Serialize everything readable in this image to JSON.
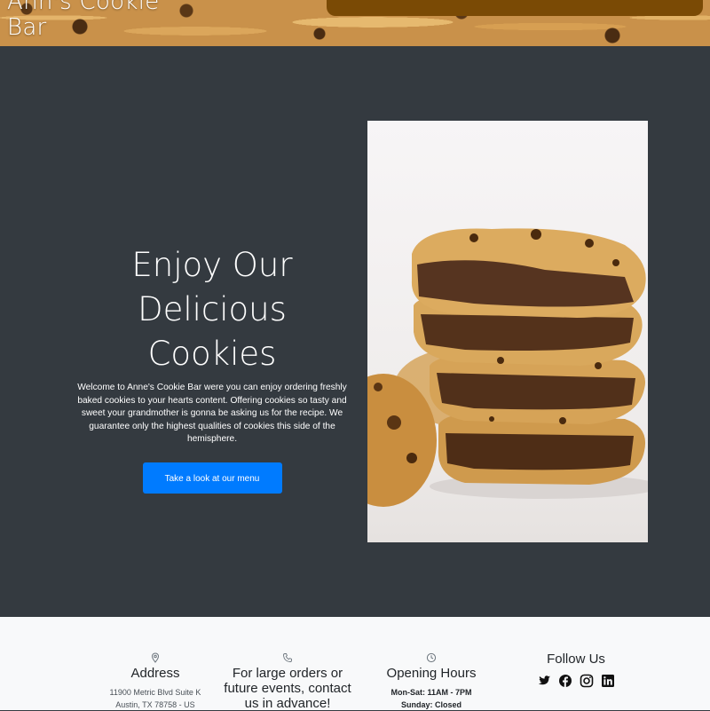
{
  "brand": {
    "name": "Ann's Cookie Bar"
  },
  "hero": {
    "title": "Enjoy Our Delicious Cookies",
    "description": "Welcome to Anne's Cookie Bar were you can enjoy ordering freshly baked cookies to your hearts content. Offering cookies so tasty and sweet your grandmother is gonna be asking us for the recipe. We guarantee only the highest qualities of cookies this side of the hemisphere.",
    "cta_label": "Take a look at our menu",
    "photo_icon": "cookie-stack-photo"
  },
  "footer": {
    "address": {
      "icon": "map-pin-icon",
      "heading": "Address",
      "line1": "11900 Metric Blvd Suite K",
      "line2": "Austin, TX 78758 - US"
    },
    "contact": {
      "icon": "phone-icon",
      "heading": "For large orders or future events, contact us in advance!"
    },
    "hours": {
      "icon": "clock-icon",
      "heading": "Opening Hours",
      "weekdays": "Mon-Sat: 11AM - 7PM",
      "sunday": "Sunday: Closed"
    },
    "social": {
      "heading": "Follow Us",
      "icons": [
        "twitter-icon",
        "facebook-icon",
        "instagram-icon",
        "linkedin-icon"
      ]
    }
  },
  "colors": {
    "hero_bg": "#343a40",
    "footer_bg": "#f8f9fa",
    "cta": "#007bff",
    "topbar": "#7a4a05"
  }
}
